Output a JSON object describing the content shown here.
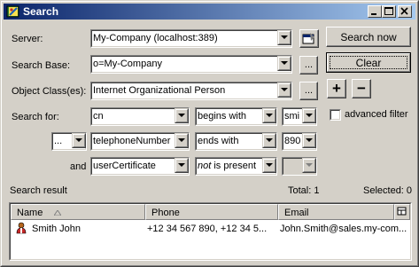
{
  "window": {
    "title": "Search",
    "icon": "app-book-icon"
  },
  "labels": {
    "server": "Server:",
    "search_base": "Search Base:",
    "object_class": "Object Class(es):",
    "search_for": "Search for:",
    "and": "and",
    "advanced_filter": "advanced filter",
    "search_result": "Search result"
  },
  "fields": {
    "server": "My-Company (localhost:389)",
    "search_base": "o=My-Company",
    "object_class": "Internet Organizational Person",
    "browse_ellipsis": "...",
    "row1": {
      "attribute": "cn",
      "condition": "begins with",
      "value": "smi"
    },
    "row2": {
      "logic": "...",
      "attribute": "telephoneNumber",
      "condition": "ends with",
      "value": "890"
    },
    "row3": {
      "attribute": "userCertificate",
      "negation": "not",
      "condition": "is present",
      "value": ""
    }
  },
  "buttons": {
    "search_now": "Search now",
    "clear": "Clear",
    "add": "+",
    "remove": "−"
  },
  "status": {
    "total": "Total: 1",
    "selected": "Selected: 0"
  },
  "results": {
    "columns": [
      "Name",
      "Phone",
      "Email"
    ],
    "rows": [
      {
        "name": "Smith John",
        "phone": "+12 34 567 890, +12 34 5...",
        "email": "John.Smith@sales.my-com..."
      }
    ]
  },
  "advanced_filter_checked": false
}
